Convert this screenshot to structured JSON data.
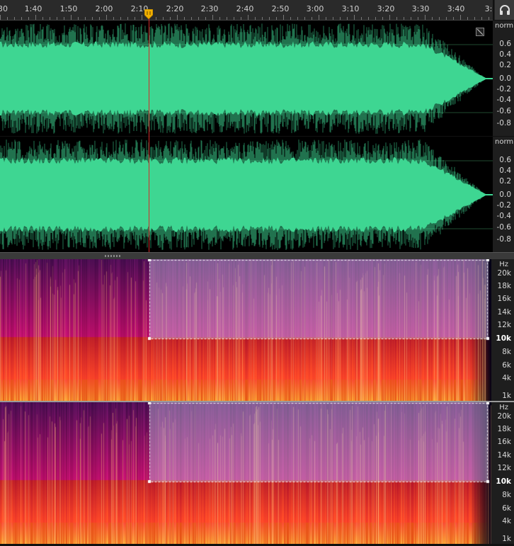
{
  "timeline": {
    "ticks": [
      "30",
      "1:40",
      "1:50",
      "2:00",
      "2:10",
      "2:20",
      "2:30",
      "2:40",
      "2:50",
      "3:00",
      "3:10",
      "3:20",
      "3:30",
      "3:40",
      "3:"
    ]
  },
  "waveform": {
    "color": "#3fd693",
    "amp_unit": "norm",
    "amp_labels": [
      "0.6",
      "0.4",
      "0.2",
      "0.0",
      "-0.2",
      "-0.4",
      "-0.6",
      "-0.8"
    ],
    "fade_start_fraction": 0.86,
    "channels": [
      "top",
      "bottom"
    ]
  },
  "spectral": {
    "unit": "Hz",
    "freq_labels": [
      "20k",
      "18k",
      "16k",
      "14k",
      "12k",
      "10k",
      "8k",
      "6k",
      "4k",
      "1k"
    ],
    "highlighted_label": "10k",
    "selection": {
      "start_time": "2:10",
      "freq_low": "10k",
      "freq_high": "20k+"
    }
  },
  "playhead": {
    "time": "2:10",
    "color": "#d42a2a",
    "marker_color": "#f0b000"
  },
  "icons": {
    "headphone": "headphone-icon",
    "maximize": "expand-icon"
  }
}
